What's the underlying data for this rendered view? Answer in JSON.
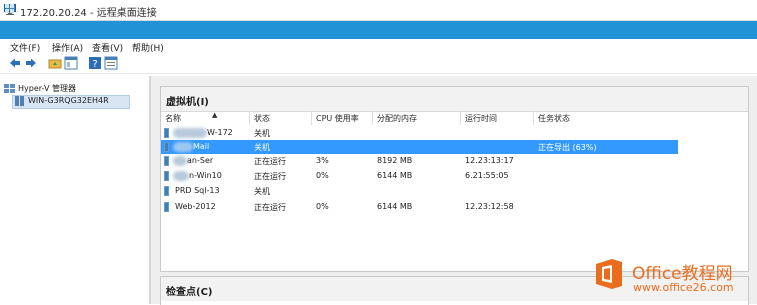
{
  "remote_window": {
    "title": "172.20.20.24 - 远程桌面连接"
  },
  "app_window": {
    "title": "Hyper-V 管理器"
  },
  "menu": {
    "items": [
      "文件(F)",
      "操作(A)",
      "查看(V)",
      "帮助(H)"
    ]
  },
  "toolbar": {
    "icons": [
      "back-arrow-icon",
      "forward-arrow-icon",
      "folder-up-icon",
      "console-view-icon",
      "help-icon",
      "properties-icon"
    ]
  },
  "tree": {
    "root": "Hyper-V 管理器",
    "server": "WIN-G3RQG32EH4R"
  },
  "vm_section": {
    "title": "虚拟机(I)",
    "columns": [
      "名称",
      "状态",
      "CPU 使用率",
      "分配的内存",
      "运行时间",
      "任务状态"
    ],
    "rows": [
      {
        "name": "W-172",
        "state": "关机",
        "cpu": "",
        "memory": "",
        "uptime": "",
        "task": ""
      },
      {
        "name": "Mail",
        "state": "关机",
        "cpu": "",
        "memory": "",
        "uptime": "",
        "task": "正在导出 (63%)",
        "selected": true
      },
      {
        "name": "an-Ser",
        "state": "正在运行",
        "cpu": "3%",
        "memory": "8192 MB",
        "uptime": "12.23:13:17",
        "task": ""
      },
      {
        "name": "n-Win10",
        "state": "正在运行",
        "cpu": "0%",
        "memory": "6144 MB",
        "uptime": "6.21:55:05",
        "task": ""
      },
      {
        "name": "PRD Sql-13",
        "state": "关机",
        "cpu": "",
        "memory": "",
        "uptime": "",
        "task": ""
      },
      {
        "name": "Web-2012",
        "state": "正在运行",
        "cpu": "0%",
        "memory": "6144 MB",
        "uptime": "12.23:12:58",
        "task": ""
      }
    ]
  },
  "checkpoint_section": {
    "title": "检查点(C)"
  },
  "watermark": {
    "brand": "Office教程网",
    "url": "www.office26.com"
  }
}
